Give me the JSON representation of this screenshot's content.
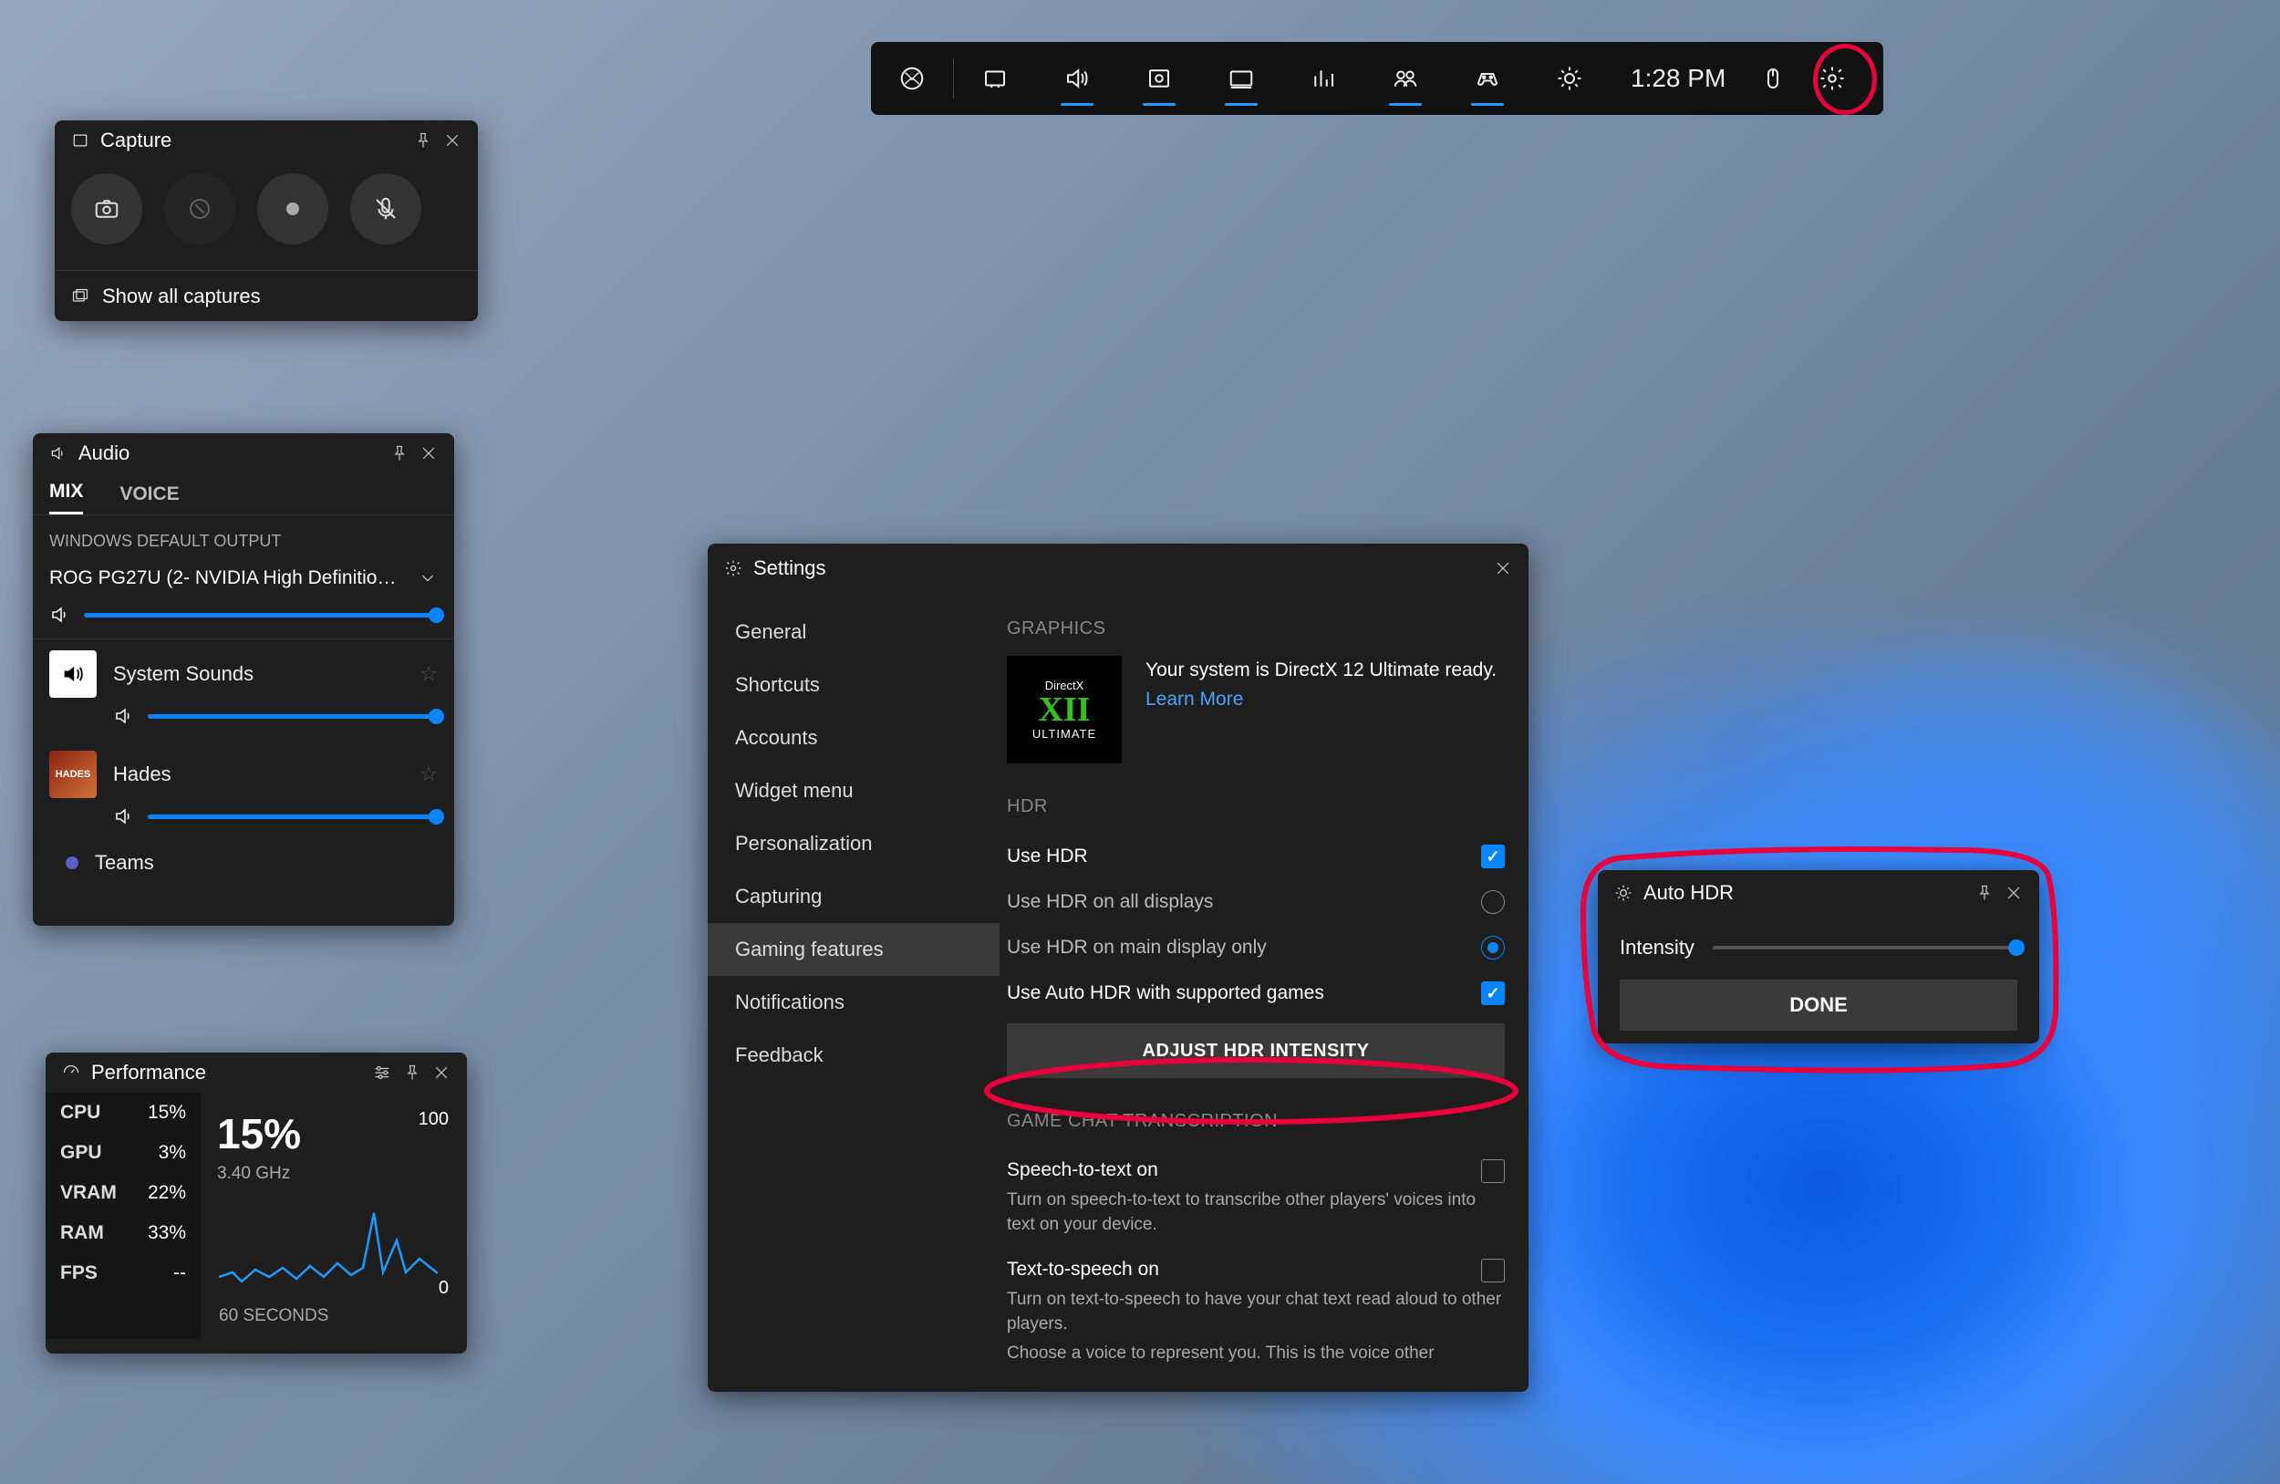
{
  "gamebar": {
    "time": "1:28 PM",
    "icons": [
      "xbox",
      "widgets",
      "audio",
      "capture",
      "perf",
      "resources",
      "social",
      "controller",
      "brightness",
      "mouse",
      "settings"
    ]
  },
  "capture": {
    "title": "Capture",
    "show_all": "Show all captures"
  },
  "audio": {
    "title": "Audio",
    "tabs": {
      "mix": "MIX",
      "voice": "VOICE"
    },
    "default_output_label": "WINDOWS DEFAULT OUTPUT",
    "device": "ROG PG27U (2- NVIDIA High Definition A...",
    "apps": [
      {
        "name": "System Sounds"
      },
      {
        "name": "Hades"
      },
      {
        "name": "Teams"
      }
    ]
  },
  "perf": {
    "title": "Performance",
    "stats": [
      {
        "label": "CPU",
        "value": "15%"
      },
      {
        "label": "GPU",
        "value": "3%"
      },
      {
        "label": "VRAM",
        "value": "22%"
      },
      {
        "label": "RAM",
        "value": "33%"
      },
      {
        "label": "FPS",
        "value": "--"
      }
    ],
    "big_value": "15%",
    "ghz": "3.40 GHz",
    "ymax": "100",
    "ymin": "0",
    "xaxis": "60 SECONDS"
  },
  "settings": {
    "title": "Settings",
    "nav": [
      "General",
      "Shortcuts",
      "Accounts",
      "Widget menu",
      "Personalization",
      "Capturing",
      "Gaming features",
      "Notifications",
      "Feedback"
    ],
    "active_nav": "Gaming features",
    "graphics": {
      "heading": "GRAPHICS",
      "dx_badge_top": "DirectX",
      "dx_badge_bottom": "ULTIMATE",
      "dx_text": "Your system is DirectX 12 Ultimate ready.",
      "learn_more": "Learn More"
    },
    "hdr": {
      "heading": "HDR",
      "use_hdr": "Use HDR",
      "hdr_all": "Use HDR on all displays",
      "hdr_main": "Use HDR on main display only",
      "auto_hdr": "Use Auto HDR with supported games",
      "adjust_btn": "ADJUST HDR INTENSITY"
    },
    "chat": {
      "heading": "GAME CHAT TRANSCRIPTION",
      "stt_title": "Speech-to-text on",
      "stt_desc": "Turn on speech-to-text to transcribe other players' voices into text on your device.",
      "tts_title": "Text-to-speech on",
      "tts_desc": "Turn on text-to-speech to have your chat text read aloud to other players.",
      "tts_desc2": "Choose a voice to represent you. This is the voice other"
    }
  },
  "autohdr": {
    "title": "Auto HDR",
    "intensity": "Intensity",
    "done": "DONE"
  }
}
